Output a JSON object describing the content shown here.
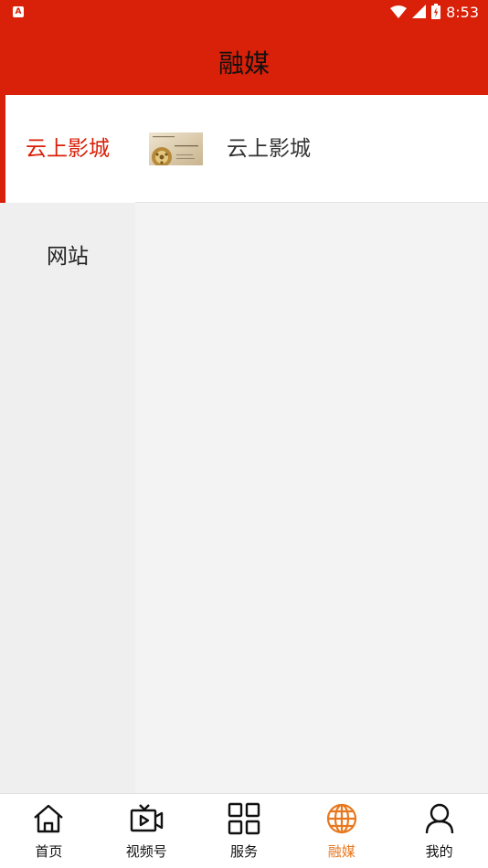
{
  "status_bar": {
    "left_icon": "a-badge-icon",
    "left_glyph": "A",
    "time": "8:53",
    "icons": [
      "wifi-icon",
      "signal-icon",
      "battery-icon"
    ]
  },
  "header": {
    "title": "融媒"
  },
  "sidebar": {
    "items": [
      {
        "label": "云上影城",
        "active": true
      },
      {
        "label": "网站",
        "active": false
      }
    ]
  },
  "content": {
    "items": [
      {
        "label": "云上影城",
        "thumbnail_icon": "film-reel-thumbnail",
        "thumbnail_text": "云上影城"
      }
    ]
  },
  "bottom_nav": {
    "items": [
      {
        "label": "首页",
        "icon": "home-icon",
        "active": false
      },
      {
        "label": "视频号",
        "icon": "tv-video-icon",
        "active": false
      },
      {
        "label": "服务",
        "icon": "grid-icon",
        "active": false
      },
      {
        "label": "融媒",
        "icon": "globe-icon",
        "active": true
      },
      {
        "label": "我的",
        "icon": "user-icon",
        "active": false
      }
    ]
  },
  "colors": {
    "brand_red": "#d92008",
    "active_nav_orange": "#e8781f",
    "sidebar_bg": "#efefef",
    "content_bg": "#f3f3f3"
  }
}
